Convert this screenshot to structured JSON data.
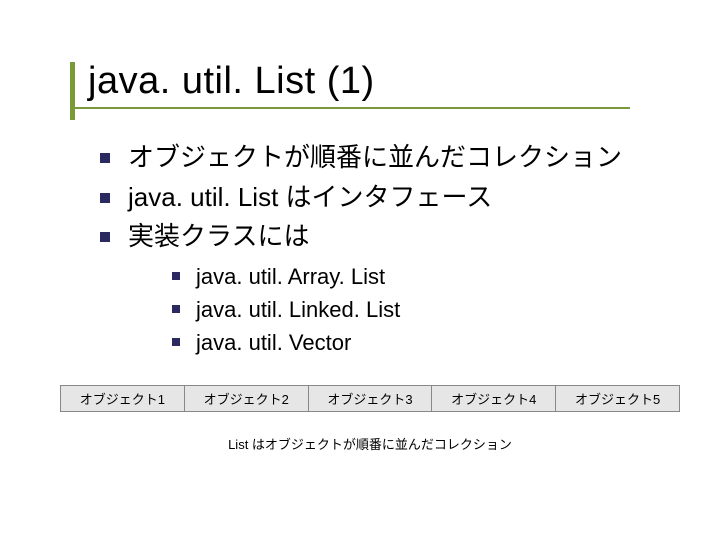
{
  "title": "java. util. List (1)",
  "bullets": [
    "オブジェクトが順番に並んだコレクション",
    "java. util. List はインタフェース",
    "実装クラスには"
  ],
  "sub_bullets": [
    "java. util. Array. List",
    "java. util. Linked. List",
    "java. util. Vector"
  ],
  "diagram": {
    "cells": [
      "オブジェクト1",
      "オブジェクト2",
      "オブジェクト3",
      "オブジェクト4",
      "オブジェクト5"
    ],
    "caption": "List はオブジェクトが順番に並んだコレクション"
  }
}
